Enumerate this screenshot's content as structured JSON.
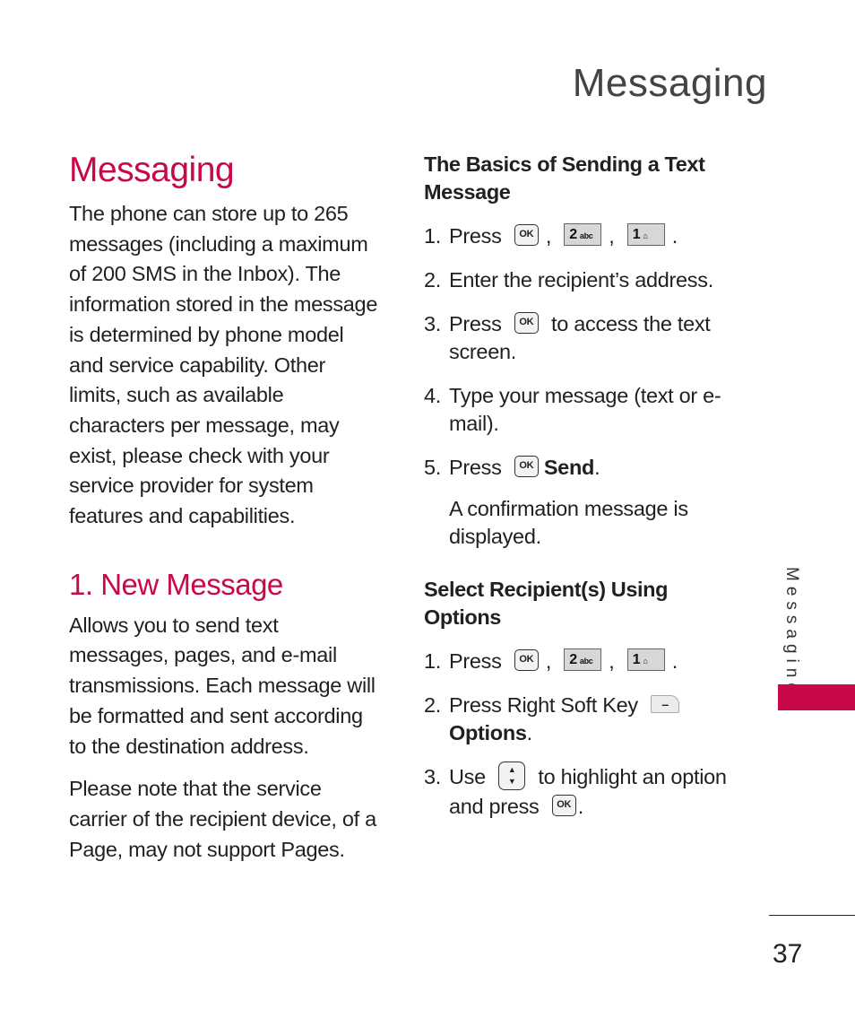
{
  "running_head": "Messaging",
  "left_column": {
    "section_title": "Messaging",
    "intro": "The phone can store up to 265 messages (including a maximum of 200 SMS in the Inbox). The information stored in the message is determined by phone model and service capability. Other limits, such as available characters per message, may exist, please check with your service provider for system features and capabilities.",
    "subsection_title": "1. New Message",
    "paragraphs": [
      "Allows you to send text messages, pages, and e-mail transmissions. Each message will be formatted and sent according to the destination address.",
      "Please note that the service carrier of the recipient device, of a Page, may not support Pages."
    ]
  },
  "right_column": {
    "basics": {
      "heading": "The Basics of Sending a Text Message",
      "steps": [
        {
          "num": "1.",
          "text_before": "Press",
          "sep1": ",",
          "sep2": ",",
          "end": "."
        },
        {
          "num": "2.",
          "text": "Enter the recipient’s address."
        },
        {
          "num": "3.",
          "text_before": "Press",
          "text_after": "to access the text screen."
        },
        {
          "num": "4.",
          "text": "Type your message (text or e-mail)."
        },
        {
          "num": "5.",
          "text_before": "Press",
          "bold": "Send",
          "end": ".",
          "note": "A confirmation message is displayed."
        }
      ]
    },
    "select": {
      "heading": "Select Recipient(s) Using Options",
      "steps": [
        {
          "num": "1.",
          "text_before": "Press",
          "sep1": ",",
          "sep2": ",",
          "end": "."
        },
        {
          "num": "2.",
          "text_before": "Press Right Soft Key",
          "bold": "Options",
          "end": "."
        },
        {
          "num": "3.",
          "text_before": "Use",
          "text_after": "to highlight an option and press",
          "end": "."
        }
      ]
    }
  },
  "keys": {
    "ok": "OK",
    "two_digit": "2",
    "two_letters": "abc",
    "one_digit": "1",
    "one_symbol": "⌂",
    "nav_up": "▲",
    "nav_down": "▼",
    "soft": "–"
  },
  "side_tab": {
    "label": "Messaging",
    "color": "#c8084a"
  },
  "page_number": "37",
  "accent_color": "#c8084a"
}
